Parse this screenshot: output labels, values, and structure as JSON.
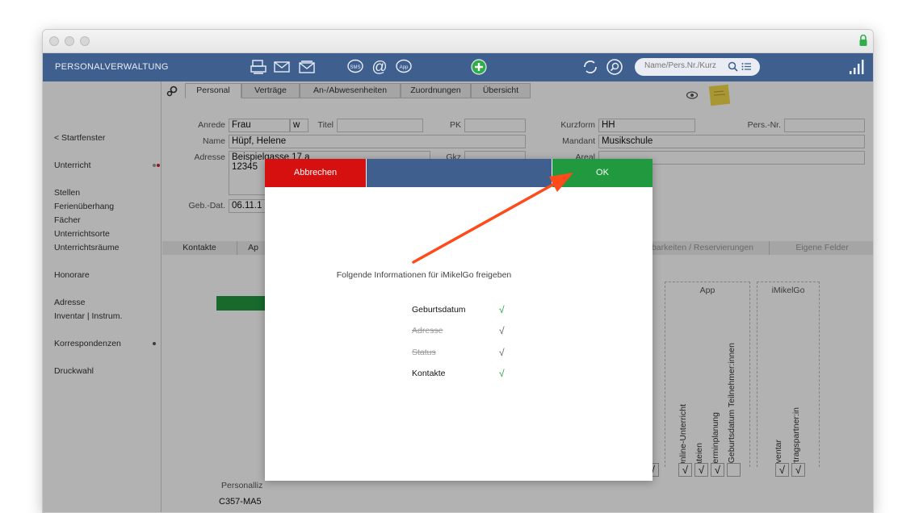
{
  "app": {
    "title": "PERSONALVERWALTUNG"
  },
  "toolbar": {
    "icons": [
      "printer-icon",
      "mail-icon",
      "letter-icon",
      "sms-icon",
      "at-icon",
      "app-icon",
      "add-icon",
      "refresh-icon",
      "search-icon"
    ],
    "search_placeholder": "Name/Pers.Nr./Kurz"
  },
  "sidebar": {
    "items": [
      "< Startfenster",
      "Unterricht",
      "Stellen",
      "Ferienüberhang",
      "Fächer",
      "Unterrichtsorte",
      "Unterrichtsräume",
      "Honorare",
      "Adresse",
      "Inventar | Instrum.",
      "Korrespondenzen",
      "Druckwahl"
    ],
    "status_colors": {
      "unterricht": [
        "#999999",
        "#d62020"
      ],
      "korrespondenzen": "#555555"
    }
  },
  "tabs": [
    "Personal",
    "Verträge",
    "An-/Abwesenheiten",
    "Zuordnungen",
    "Übersicht"
  ],
  "form": {
    "anrede_label": "Anrede",
    "anrede_value": "Frau",
    "gender_value": "w",
    "titel_label": "Titel",
    "titel_value": "",
    "pk_label": "PK",
    "pk_value": "",
    "kurzform_label": "Kurzform",
    "kurzform_value": "HH",
    "persnr_label": "Pers.-Nr.",
    "persnr_value": "",
    "name_label": "Name",
    "name_value": "Hüpf, Helene",
    "mandant_label": "Mandant",
    "mandant_value": "Musikschule",
    "adresse_label": "Adresse",
    "adresse_line1": "Beispielgasse 17 a",
    "adresse_line2": "12345",
    "gkz_label": "Gkz",
    "areal_label": "Areal",
    "gebdat_label": "Geb.-Dat.",
    "gebdat_value": "06.11.1"
  },
  "subtabs": {
    "kontakte": "Kontakte",
    "ap": "Ap",
    "reservierungen": "barkeiten / Reservierungen",
    "eigene": "Eigene Felder"
  },
  "bottom": {
    "personalliz_label": "Personalliz",
    "personalliz_value": "C357-MA5"
  },
  "columns": {
    "app_header": "App",
    "imikelgo_header": "iMikelGo",
    "app_items": [
      "Online-Unterricht",
      "Dateien",
      "Terminplanung",
      "Geburtsdatum Teilnehmer:innen"
    ],
    "imikelgo_items": [
      "Inventar",
      "Vertragspartner:in"
    ],
    "checks": [
      "√",
      "√",
      "√",
      "√",
      "",
      "√",
      "√"
    ]
  },
  "dialog": {
    "cancel_label": "Abbrechen",
    "ok_label": "OK",
    "message": "Folgende Informationen für iMikelGo freigeben",
    "options": [
      {
        "label": "Geburtsdatum",
        "enabled": true,
        "check": "√",
        "check_color": "#21993f"
      },
      {
        "label": "Adresse",
        "enabled": false,
        "check": "√",
        "check_color": "#555555"
      },
      {
        "label": "Status",
        "enabled": false,
        "check": "√",
        "check_color": "#555555"
      },
      {
        "label": "Kontakte",
        "enabled": true,
        "check": "√",
        "check_color": "#21993f"
      }
    ],
    "arrow_color": "#ff4a1a"
  }
}
